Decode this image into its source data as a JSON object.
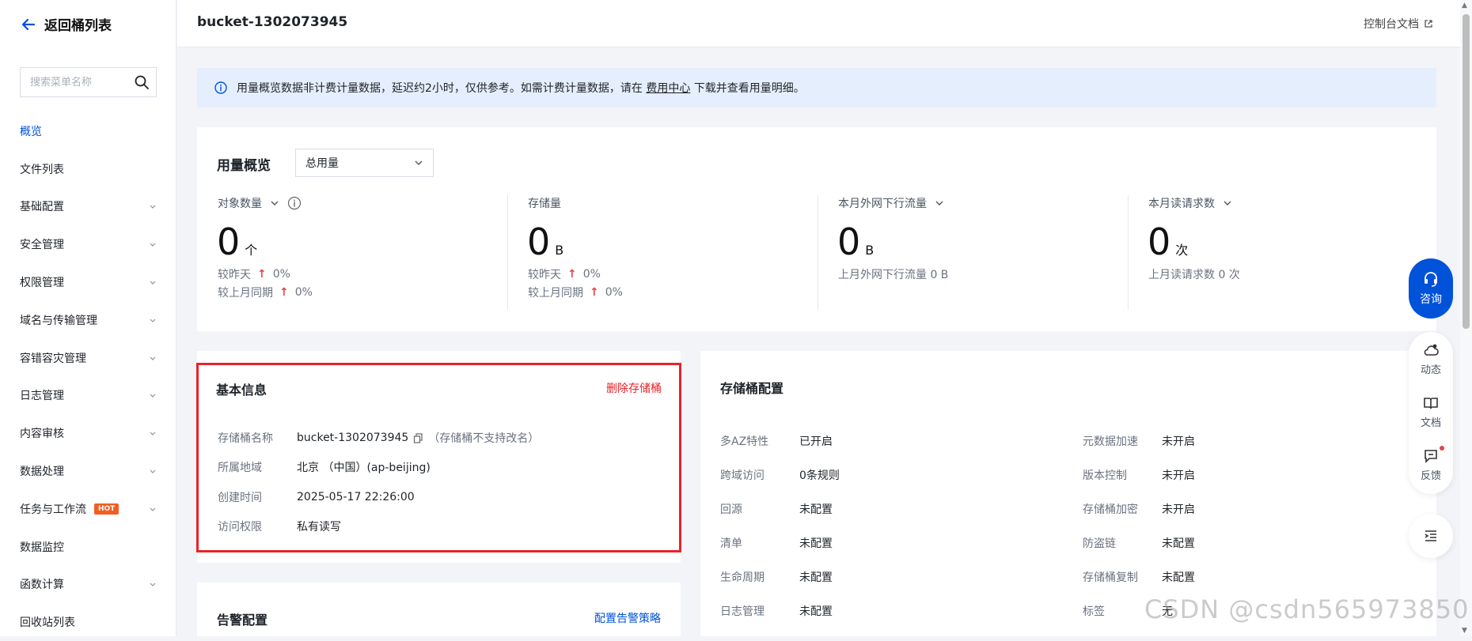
{
  "sidebar": {
    "back_label": "返回桶列表",
    "search_placeholder": "搜索菜单名称",
    "items": [
      {
        "label": "概览",
        "active": true,
        "expandable": false
      },
      {
        "label": "文件列表",
        "expandable": false
      },
      {
        "label": "基础配置",
        "expandable": true
      },
      {
        "label": "安全管理",
        "expandable": true
      },
      {
        "label": "权限管理",
        "expandable": true
      },
      {
        "label": "域名与传输管理",
        "expandable": true
      },
      {
        "label": "容错容灾管理",
        "expandable": true
      },
      {
        "label": "日志管理",
        "expandable": true
      },
      {
        "label": "内容审核",
        "expandable": true
      },
      {
        "label": "数据处理",
        "expandable": true
      },
      {
        "label": "任务与工作流",
        "expandable": true,
        "badge": "HOT"
      },
      {
        "label": "数据监控",
        "expandable": false
      },
      {
        "label": "函数计算",
        "expandable": true
      },
      {
        "label": "回收站列表",
        "expandable": false
      }
    ]
  },
  "header": {
    "bucket_name": "bucket-1302073945",
    "doc_link": "控制台文档"
  },
  "notice": {
    "text_before": "用量概览数据非计费计量数据，延迟约2小时，仅供参考。如需计费计量数据，请在",
    "link": "费用中心",
    "text_after": "下载并查看用量明细。"
  },
  "usage": {
    "title": "用量概览",
    "select_value": "总用量",
    "metrics": [
      {
        "label": "对象数量",
        "value": "0",
        "unit": "个",
        "sub1_label": "较昨天",
        "sub1_value": "0%",
        "sub2_label": "较上月同期",
        "sub2_value": "0%"
      },
      {
        "label": "存储量",
        "value": "0",
        "unit": "B",
        "sub1_label": "较昨天",
        "sub1_value": "0%",
        "sub2_label": "较上月同期",
        "sub2_value": "0%"
      },
      {
        "label": "本月外网下行流量",
        "value": "0",
        "unit": "B",
        "sub1": "上月外网下行流量 0 B"
      },
      {
        "label": "本月读请求数",
        "value": "0",
        "unit": "次",
        "sub1": "上月读请求数 0 次"
      }
    ]
  },
  "basic_info": {
    "title": "基本信息",
    "delete_label": "删除存储桶",
    "rows": [
      {
        "key": "存储桶名称",
        "value": "bucket-1302073945",
        "hint": "（存储桶不支持改名）"
      },
      {
        "key": "所属地域",
        "value": "北京 （中国）(ap-beijing)"
      },
      {
        "key": "创建时间",
        "value": "2025-05-17 22:26:00"
      },
      {
        "key": "访问权限",
        "value": "私有读写"
      }
    ]
  },
  "alert": {
    "title": "告警配置",
    "link": "配置告警策略"
  },
  "bucket_config": {
    "title": "存储桶配置",
    "left": [
      {
        "key": "多AZ特性",
        "value": "已开启"
      },
      {
        "key": "跨域访问",
        "value": "0条规则"
      },
      {
        "key": "回源",
        "value": "未配置"
      },
      {
        "key": "清单",
        "value": "未配置"
      },
      {
        "key": "生命周期",
        "value": "未配置"
      },
      {
        "key": "日志管理",
        "value": "未配置"
      }
    ],
    "right": [
      {
        "key": "元数据加速",
        "value": "未开启"
      },
      {
        "key": "版本控制",
        "value": "未开启"
      },
      {
        "key": "存储桶加密",
        "value": "未开启"
      },
      {
        "key": "防盗链",
        "value": "未配置"
      },
      {
        "key": "存储桶复制",
        "value": "未配置"
      },
      {
        "key": "标签",
        "value": "无"
      }
    ]
  },
  "float": {
    "consult": "咨询",
    "dynamic": "动态",
    "docs": "文档",
    "feedback": "反馈"
  },
  "watermark": "CSDN @csdn565973850",
  "colors": {
    "brand": "#0052d9",
    "danger": "#e8232a",
    "hot": "#f35d23",
    "notice_bg": "#e5eefd"
  }
}
